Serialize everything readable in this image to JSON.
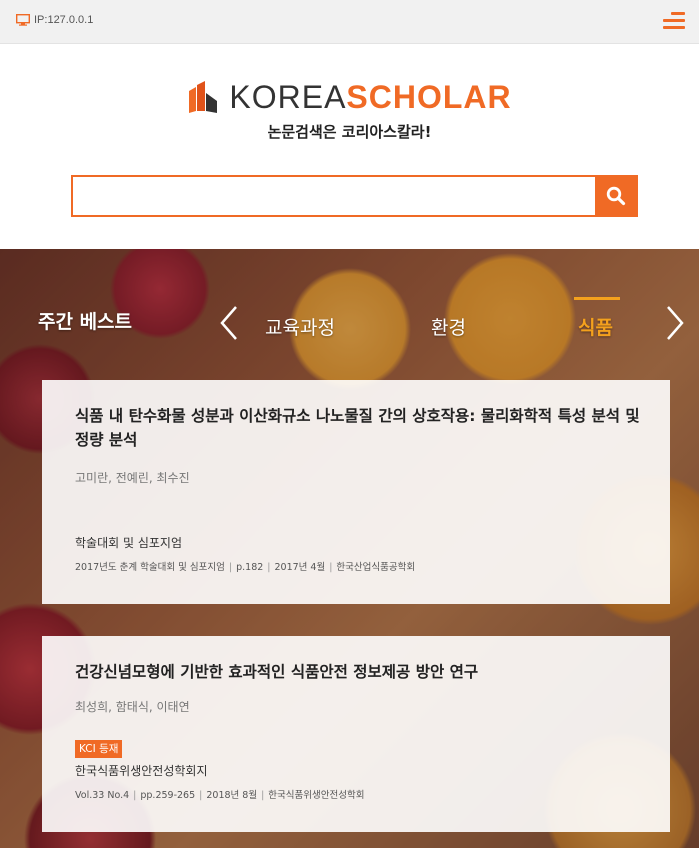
{
  "topbar": {
    "ip_text": "IP:127.0.0.1",
    "monitor_icon": "monitor-icon",
    "menu_icon": "hamburger-menu-icon"
  },
  "header": {
    "logo_korea": "KOREA",
    "logo_scholar": "SCHOLAR",
    "tagline": "논문검색은 코리아스칼라!",
    "search_placeholder": "",
    "search_icon": "search-icon"
  },
  "colors": {
    "accent": "#f06a25",
    "category_active": "#f4a11d"
  },
  "weekly_best": {
    "title": "주간 베스트",
    "categories": [
      {
        "label": "교육과정",
        "active": false
      },
      {
        "label": "환경",
        "active": false
      },
      {
        "label": "식품",
        "active": true
      }
    ],
    "prev_icon": "chevron-left-icon",
    "next_icon": "chevron-right-icon"
  },
  "papers": [
    {
      "title": "식품 내 탄수화물 성분과 이산화규소 나노물질 간의 상호작용: 물리화학적 특성 분석 및 정량 분석",
      "authors": "고미란, 전예린, 최수진",
      "badge": "",
      "source": "학술대회 및 심포지엄",
      "meta": [
        "2017년도 춘계 학술대회 및 심포지엄",
        "p.182",
        "2017년 4월",
        "한국산업식품공학회"
      ]
    },
    {
      "title": "건강신념모형에 기반한 효과적인 식품안전 정보제공 방안 연구",
      "authors": "최성희, 함태식, 이태연",
      "badge": "KCI 등재",
      "source": "한국식품위생안전성학회지",
      "meta": [
        "Vol.33 No.4",
        "pp.259-265",
        "2018년 8월",
        "한국식품위생안전성학회"
      ]
    }
  ]
}
